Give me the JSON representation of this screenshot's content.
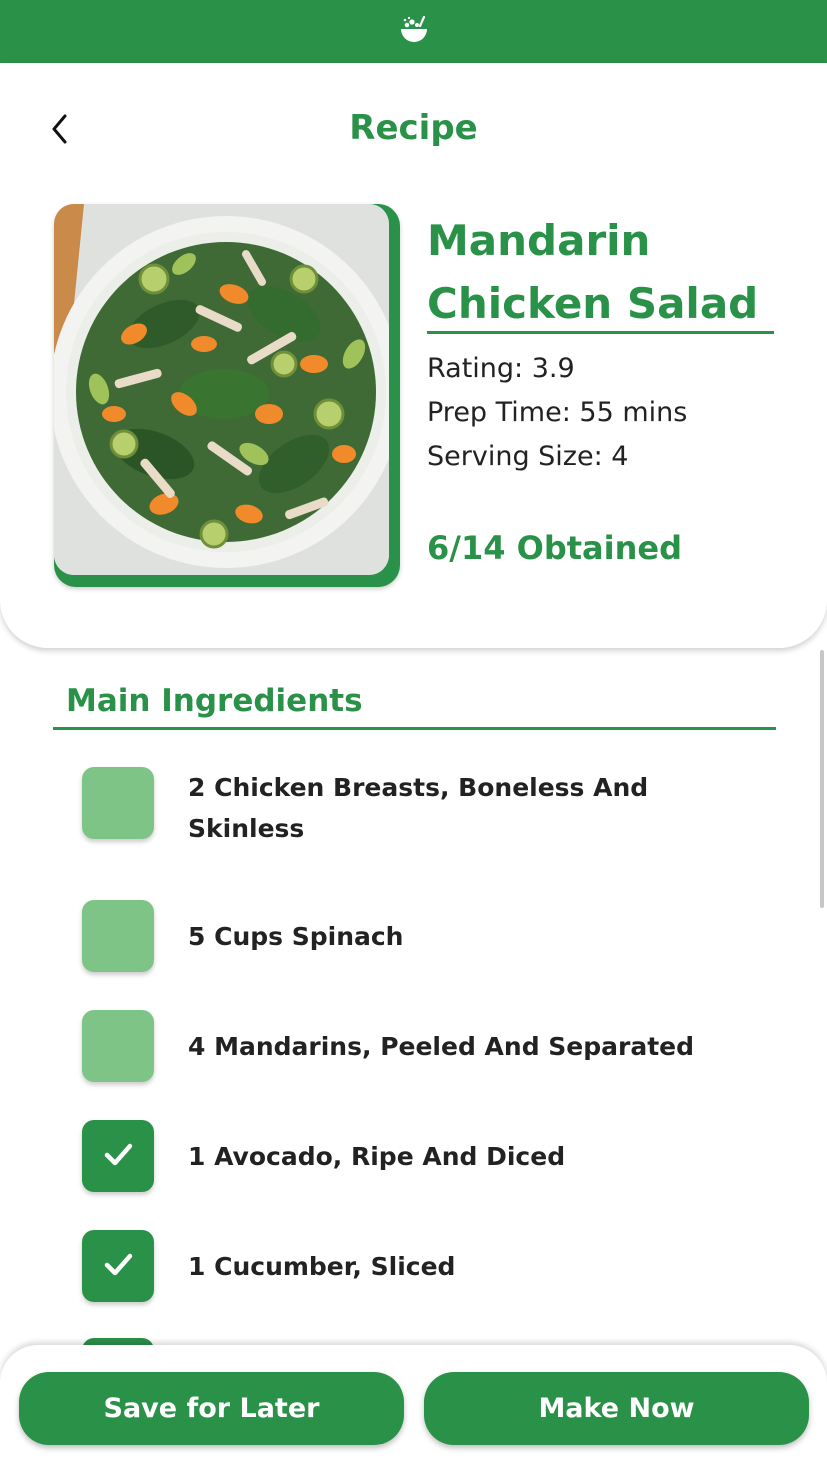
{
  "header": {
    "logo_icon": "salad-bowl-icon",
    "title": "Recipe"
  },
  "recipe": {
    "name_line1": "Mandarin",
    "name_line2": "Chicken Salad",
    "rating": "Rating: 3.9",
    "prep_time": "Prep Time: 55 mins",
    "serving_size": "Serving Size: 4",
    "obtained": "6/14 Obtained"
  },
  "ingredients": {
    "section_title": "Main Ingredients",
    "items": [
      {
        "label": "2 Chicken Breasts, Boneless And Skinless",
        "checked": false
      },
      {
        "label": "5 Cups Spinach",
        "checked": false
      },
      {
        "label": "4 Mandarins, Peeled And Separated",
        "checked": false
      },
      {
        "label": "1 Avocado, Ripe And Diced",
        "checked": true
      },
      {
        "label": "1 Cucumber, Sliced",
        "checked": true
      }
    ]
  },
  "actions": {
    "save_label": "Save for Later",
    "make_label": "Make Now"
  },
  "colors": {
    "brand_green": "#2a9148",
    "unchecked_green": "#7fc487"
  }
}
